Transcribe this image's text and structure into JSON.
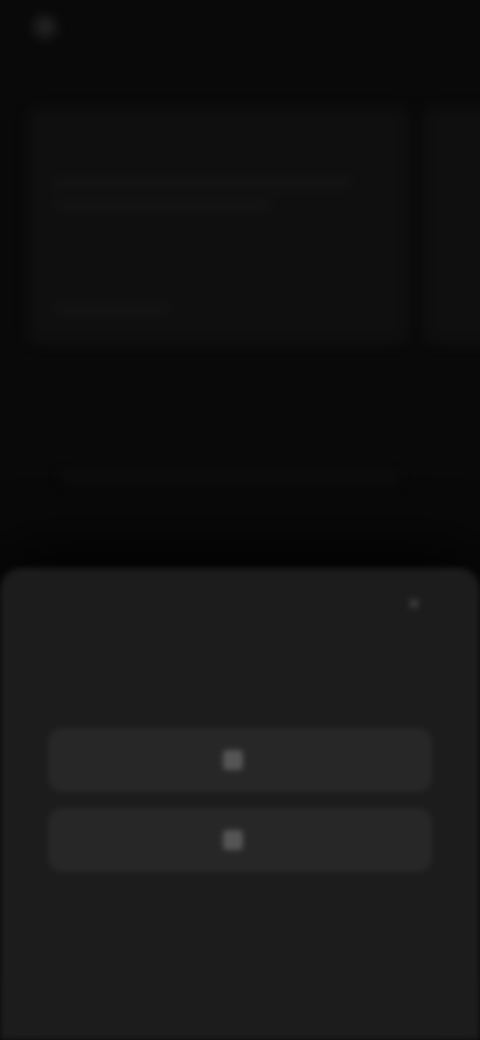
{
  "topbar": {
    "brand_name": "",
    "brand_sub": "",
    "action_label": ""
  },
  "cards": [
    {
      "title": ""
    },
    {
      "title": ""
    }
  ],
  "section": {
    "label": ""
  },
  "sheet": {
    "heading": "",
    "buttons": [
      {
        "label": ""
      },
      {
        "label": ""
      }
    ],
    "footer_link": ""
  },
  "colors": {
    "background": "#090909",
    "sheet": "#1c1c1c",
    "button": "#272727"
  },
  "icons": {
    "close": "close-icon",
    "button_icon": "app-icon"
  }
}
